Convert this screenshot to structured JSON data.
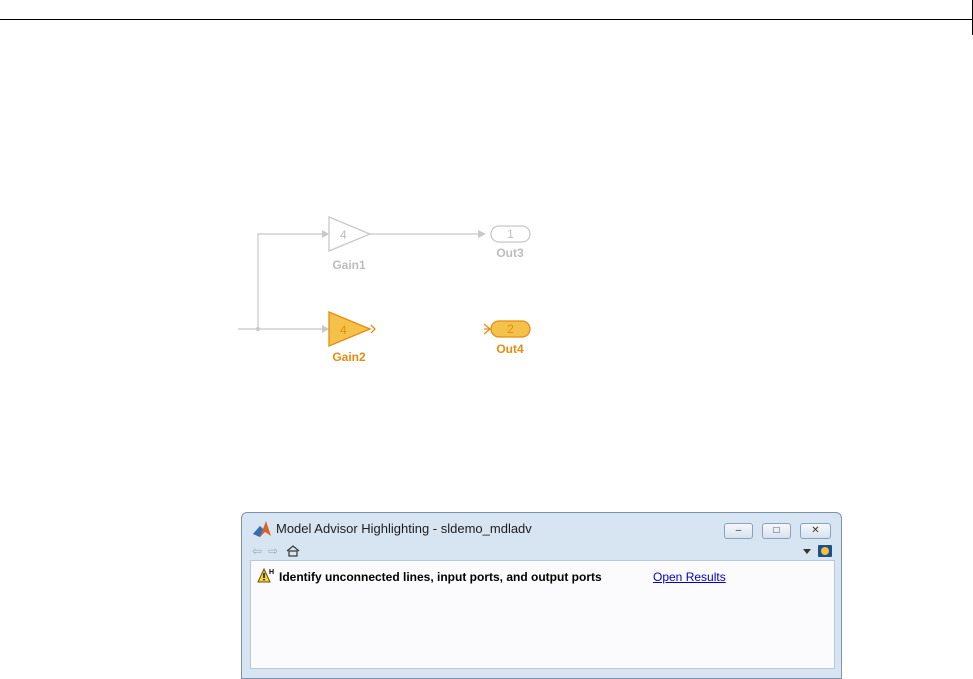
{
  "diagram": {
    "blocks": [
      {
        "name": "gain1",
        "kind": "gain",
        "value": "4",
        "label": "Gain1",
        "highlighted": false
      },
      {
        "name": "gain2",
        "kind": "gain",
        "value": "4",
        "label": "Gain2",
        "highlighted": true
      },
      {
        "name": "out3",
        "kind": "outport",
        "value": "1",
        "label": "Out3",
        "highlighted": false
      },
      {
        "name": "out4",
        "kind": "outport",
        "value": "2",
        "label": "Out4",
        "highlighted": true
      }
    ],
    "colors": {
      "dimmed_stroke": "#c8c8c8",
      "dimmed_text": "#bdbdbd",
      "highlight_fill": "#f4c24b",
      "highlight_stroke": "#e88b10",
      "highlight_text": "#e88b10"
    }
  },
  "window": {
    "title": "Model Advisor Highlighting - sldemo_mdladv",
    "buttons": {
      "minimize": "–",
      "maximize": "□",
      "close": "✕"
    },
    "toolbar": {
      "back_icon": "back-arrow-icon",
      "forward_icon": "forward-arrow-icon",
      "home_icon": "home-icon",
      "menu_icon": "dropdown-icon",
      "help_icon": "help-icon"
    },
    "message": {
      "icon": "warning-icon",
      "badge": "H",
      "text": "Identify unconnected lines, input ports, and output ports",
      "link": "Open Results"
    }
  }
}
